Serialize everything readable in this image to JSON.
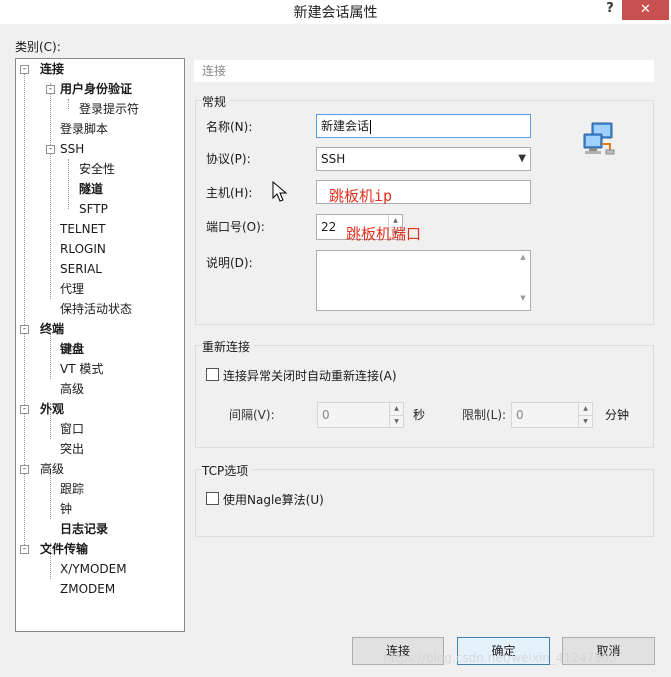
{
  "window": {
    "title": "新建会话属性",
    "help": "?",
    "close": "✕"
  },
  "category": {
    "label": "类别(C):",
    "tree": [
      "连接",
      "用户身份验证",
      "登录提示符",
      "登录脚本",
      "SSH",
      "安全性",
      "隧道",
      "SFTP",
      "TELNET",
      "RLOGIN",
      "SERIAL",
      "代理",
      "保持活动状态",
      "终端",
      "键盘",
      "VT 模式",
      "高级",
      "外观",
      "窗口",
      "突出",
      "高级",
      "跟踪",
      "钟",
      "日志记录",
      "文件传输",
      "X/YMODEM",
      "ZMODEM"
    ],
    "expanders": [
      "-",
      "-",
      "-",
      "-",
      "-",
      "-",
      "-"
    ]
  },
  "breadcrumb": "连接",
  "general": {
    "label": "常规",
    "name_label": "名称(N):",
    "name_value": "新建会话",
    "protocol_label": "协议(P):",
    "protocol_value": "SSH",
    "host_label": "主机(H):",
    "host_value": "跳板机ip",
    "port_label": "端口号(O):",
    "port_value": "22",
    "port_annotation": "跳板机端口",
    "desc_label": "说明(D):"
  },
  "reconnect": {
    "label": "重新连接",
    "checkbox_label": "连接异常关闭时自动重新连接(A)",
    "interval_label": "间隔(V):",
    "interval_value": "0",
    "interval_unit": "秒",
    "limit_label": "限制(L):",
    "limit_value": "0",
    "limit_unit": "分钟"
  },
  "tcp": {
    "label": "TCP选项",
    "nagle_label": "使用Nagle算法(U)"
  },
  "buttons": {
    "connect": "连接",
    "ok": "确定",
    "cancel": "取消"
  },
  "watermark": "https://blog.csdn.net/weixin_41247503",
  "colors": {
    "close_button": "#c75050",
    "annotation": "#e0301e",
    "focus_border": "#569de5"
  },
  "icons": {
    "session": "network-computers-icon",
    "cursor": "mouse-pointer-icon"
  }
}
